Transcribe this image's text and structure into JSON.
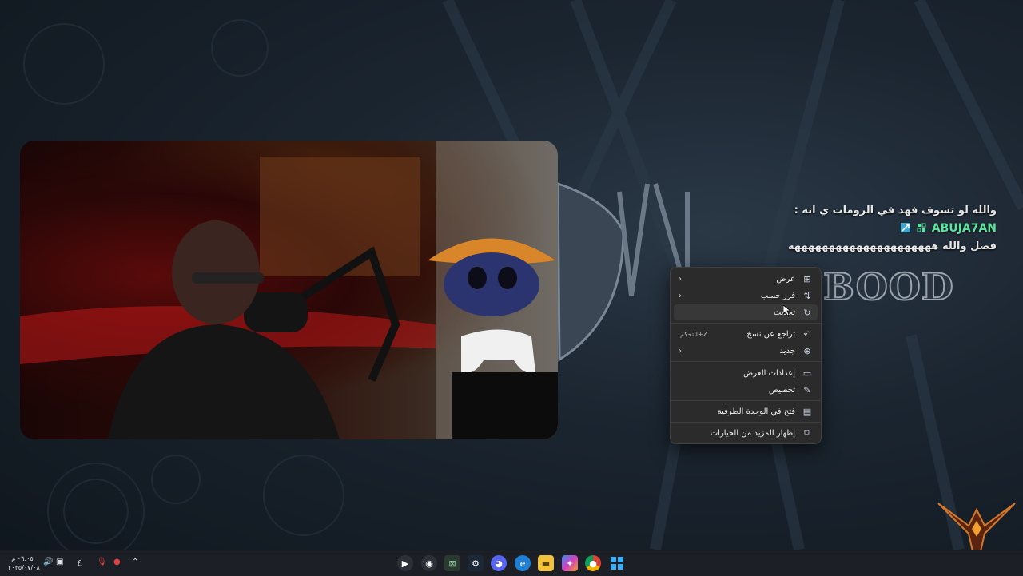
{
  "chat": {
    "username": "ABUJA7AN",
    "separator": ":",
    "message_line1": "والله لو تشوف فهد في الرومات ي انه",
    "message_line2": "فصل والله هههههههههههههههههههههه"
  },
  "logo": {
    "text": "BOOD"
  },
  "context_menu": {
    "items": [
      {
        "label": "عرض",
        "icon": "grid-view-icon",
        "submenu": true
      },
      {
        "label": "فرز حسب",
        "icon": "sort-icon",
        "submenu": true
      },
      {
        "label": "تحديث",
        "icon": "refresh-icon",
        "submenu": false
      },
      {
        "label": "تراجع عن نسخ",
        "icon": "undo-icon",
        "shortcut": "التحكم+Z"
      },
      {
        "label": "جديد",
        "icon": "new-plus-icon",
        "submenu": true
      },
      {
        "label": "إعدادات العرض",
        "icon": "display-settings-icon"
      },
      {
        "label": "تخصيص",
        "icon": "personalize-pen-icon"
      },
      {
        "label": "فتح في الوحدة الطرفية",
        "icon": "terminal-icon"
      },
      {
        "label": "إظهار المزيد من الخيارات",
        "icon": "more-options-icon"
      }
    ]
  },
  "taskbar": {
    "clock_time": "٠٦:٠٥ م",
    "clock_date": "٢٠٢٥/٠٧/٠٨",
    "language": "ع",
    "apps": [
      "media-player-icon",
      "obs-icon",
      "terminal-app-icon",
      "steam-icon",
      "discord-icon",
      "edge-icon",
      "file-explorer-icon",
      "copilot-icon",
      "chrome-icon",
      "windows-start-icon"
    ]
  },
  "colors": {
    "username": "#5ce6a0",
    "menu_bg": "#2b2b2b",
    "taskbar_bg": "#1c2026"
  }
}
